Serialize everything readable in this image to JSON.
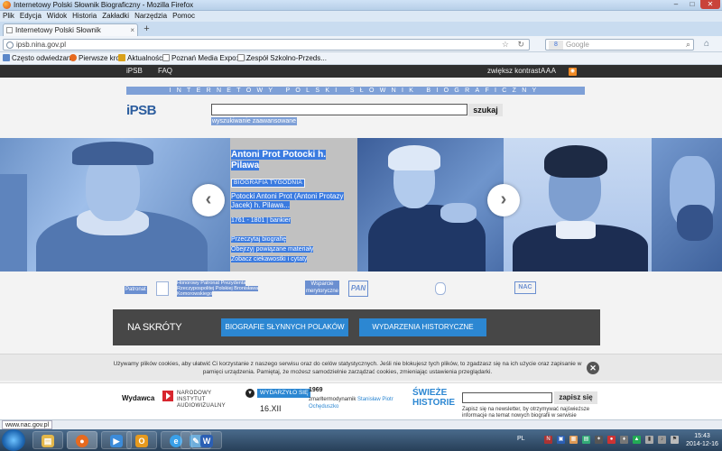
{
  "window": {
    "title": "Internetowy Polski Słownik Biograficzny - Mozilla Firefox",
    "min": "–",
    "max": "□",
    "close": "✕"
  },
  "menu": [
    "Plik",
    "Edycja",
    "Widok",
    "Historia",
    "Zakładki",
    "Narzędzia",
    "Pomoc"
  ],
  "tab": {
    "label": "Internetowy Polski Słownik Biograficzny",
    "close": "×",
    "new": "+"
  },
  "nav": {
    "url": "ipsb.nina.gov.pl",
    "search_placeholder": "Google",
    "search_engine": "8"
  },
  "bookmarks": [
    {
      "label": "Często odwiedzane",
      "color": "#5b87c9"
    },
    {
      "label": "Pierwsze kroki",
      "color": "#e66a1f"
    },
    {
      "label": "Aktualności",
      "color": "#d9a11a"
    },
    {
      "label": "Poznań Media Expo: N...",
      "color": "#888888"
    },
    {
      "label": "Zespół Szkolno-Przeds...",
      "color": "#888888"
    }
  ],
  "site": {
    "topnav": {
      "ipsb": "iPSB",
      "faq": "FAQ",
      "contrast": "zwiększ kontrast",
      "font_size": "AAA"
    },
    "tagline": "INTERNETOWY POLSKI SŁOWNIK BIOGRAFICZNY",
    "logo": "iPSB",
    "search_button": "szukaj",
    "advanced_search": "wyszukiwanie zaawansowane"
  },
  "biography": {
    "name": "Antoni Prot Potocki h. Pilawa",
    "badge": "BIOGRAFIA TYGODNIA",
    "full_name": "Potocki Antoni Prot (Antoni Protazy Jacek) h. Pilawa...",
    "dates": "1761 - 1801 | bankier",
    "links": [
      "Przeczytaj biografię",
      "Obejrzyj powiązane materiały",
      "Zobacz ciekawostki i cytaty"
    ]
  },
  "partners": {
    "patron_label": "Patronat",
    "patron_text": "Honorowy Patronat Prezydenta Rzeczypospolitej Polskiej Bronisława Komorowskiego",
    "support_label": "Wsparcie merytoryczne",
    "pan_logo": "PAN",
    "nac_logo": "NAC"
  },
  "shortcuts": {
    "title": "NA SKRÓTY",
    "btn1": "BIOGRAFIE SŁYNNYCH POLAKÓW",
    "btn2": "WYDARZENIA HISTORYCZNE"
  },
  "cookie": {
    "text": "Używamy plików cookies, aby ułatwić Ci korzystanie z naszego serwisu oraz do celów statystycznych. Jeśli nie blokujesz tych plików, to zgadzasz się na ich użycie oraz zapisanie w pamięci urządzenia. Pamiętaj, że możesz samodzielnie zarządzać cookies, zmieniając ustawienia przeglądarki.",
    "close": "✕"
  },
  "footer": {
    "wydawca": "Wydawca",
    "nina": "NARODOWY INSTYTUT AUDIOWIZUALNY",
    "happened": "WYDARZYŁO SIĘ",
    "date": "16.XII",
    "year": "1969",
    "event_prefix": "zmarł",
    "event_role": "termodynamik",
    "event_person": "Stanisław Piotr Ochęduszko",
    "fresh": "ŚWIEŻE HISTORIE",
    "subscribe": "zapisz się",
    "newsletter": "Zapisz się na newsletter, by otrzymywać najświeższe informacje na temat nowych biografii w serwisie"
  },
  "status_url": "www.nac.gov.pl",
  "taskbar": {
    "apps": [
      {
        "name": "explorer",
        "glyph": "▤",
        "color": "#e3b74a"
      },
      {
        "name": "firefox",
        "glyph": "●",
        "color": "#e66a1f"
      },
      {
        "name": "media",
        "glyph": "▶",
        "color": "#3c8bd9"
      },
      {
        "name": "outlook",
        "glyph": "O",
        "color": "#e69a1f"
      },
      {
        "name": "ie",
        "glyph": "e",
        "color": "#3aa0e8"
      },
      {
        "name": "paint",
        "glyph": "✎",
        "color": "#5aa3d6"
      },
      {
        "name": "word",
        "glyph": "W",
        "color": "#2b5fb4"
      }
    ],
    "lang": "PL",
    "time": "15:43",
    "date": "2014-12-16"
  }
}
